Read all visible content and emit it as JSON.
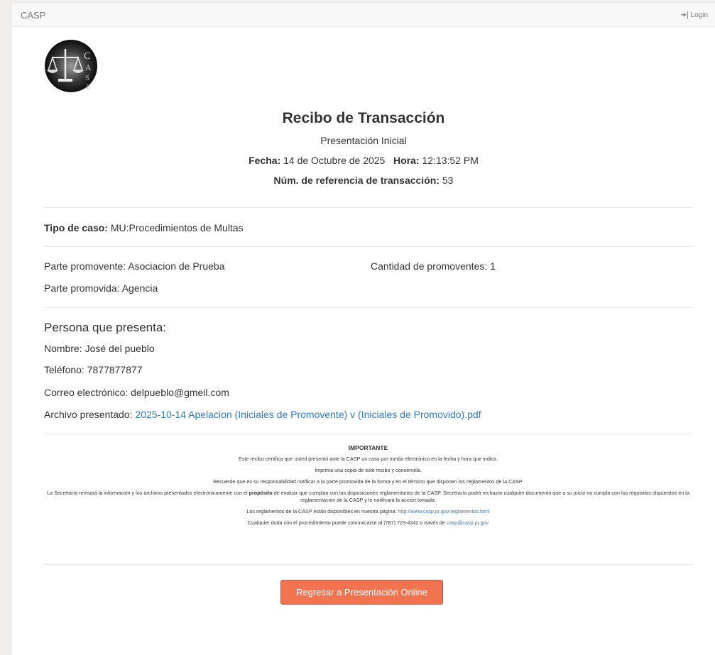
{
  "navbar": {
    "brand": "CASP",
    "login_label": "Login",
    "login_icon": "sign-in-icon"
  },
  "receipt": {
    "title": "Recibo de Transacción",
    "subtitle": "Presentación Inicial",
    "fecha_label": "Fecha:",
    "fecha_value": "14 de Octubre de 2025",
    "hora_label": "Hora:",
    "hora_value": "12:13:52 PM",
    "ref_label": "Núm. de referencia de transacción:",
    "ref_value": "53"
  },
  "case": {
    "tipo_label": "Tipo de caso:",
    "tipo_value": "MU:Procedimientos de Multas"
  },
  "parties": {
    "promovente": "Parte promovente: Asociacion de Prueba",
    "cantidad": "Cantidad de promoventes: 1",
    "promovida": "Parte promovida: Agencia"
  },
  "presenter": {
    "heading": "Persona que presenta:",
    "nombre": "Nombre: José del pueblo",
    "telefono": "Teléfono: 7877877877",
    "correo": "Correo electrónico: delpueblo@gmeil.com",
    "archivo_label": "Archivo presentado:",
    "archivo_link": "2025-10-14 Apelacion (Iniciales de Promovente) v (Iniciales de Promovido).pdf"
  },
  "notice": {
    "heading": "IMPORTANTE",
    "p1": "Este recibo certifica que usted presentó ante la CASP un caso por medio electrónico en la fecha y hora que indica.",
    "p2": "Imprima una copia de este recibo y consérvela.",
    "p3": "Recuerde que es su responsabilidad notificar a la parte promovida de la forma y en el término que disponen los reglamentos de la CASP.",
    "p4_a": "La Secretaría revisará la información y los archivos presentados electrónicamente con el",
    "p4_b": "propósito",
    "p4_c": "de evaluar que cumplan con las disposiciones reglamentarias de la CASP. Secretaría podrá rechazar cualquier documento que a su juicio no cumpla con los requisitos dispuestos en la reglamentación de la CASP y le notificará la acción tomada.",
    "p5_text": "Los reglamentos de la CASP están disponibles en nuestra página:",
    "p5_link": "http://www.casp.pr.gov/reglamentos.html",
    "p6_text": "Cualquier duda con el procedimiento puede comunicarse al (787) 723-4242 o través de",
    "p6_link": "casp@casp.pr.gov"
  },
  "button": {
    "label": "Regresar a Presentación Online"
  },
  "colors": {
    "accent": "#f2734f",
    "link": "#3378b8"
  }
}
